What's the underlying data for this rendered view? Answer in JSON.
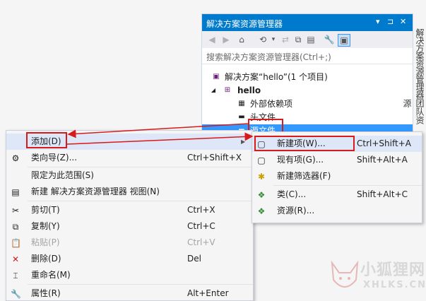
{
  "solution_explorer": {
    "title": "解决方案资源管理器",
    "pin": "▾ ⊐ ✕",
    "search_placeholder": "搜索解决方案资源管理器(Ctrl+;)",
    "tree": [
      {
        "label": "解决方案“hello”(1 个项目)"
      },
      {
        "label": "hello"
      },
      {
        "label": "外部依赖项"
      },
      {
        "label": "头文件"
      },
      {
        "label": "源文件"
      }
    ]
  },
  "side_tabs": {
    "solution": "解决方案资源管理器",
    "team": "团队资源"
  },
  "context_menu": {
    "items": [
      {
        "label": "添加(D)",
        "shortcut": ""
      },
      {
        "label": "类向导(Z)...",
        "shortcut": "Ctrl+Shift+X"
      },
      {
        "label": "限定为此范围(S)",
        "shortcut": ""
      },
      {
        "label": "新建 解决方案资源管理器 视图(N)",
        "shortcut": ""
      },
      {
        "label": "剪切(T)",
        "shortcut": "Ctrl+X"
      },
      {
        "label": "复制(Y)",
        "shortcut": "Ctrl+C"
      },
      {
        "label": "粘贴(P)",
        "shortcut": "Ctrl+V"
      },
      {
        "label": "删除(D)",
        "shortcut": "Del"
      },
      {
        "label": "重命名(M)",
        "shortcut": ""
      },
      {
        "label": "属性(R)",
        "shortcut": "Alt+Enter"
      }
    ]
  },
  "add_submenu": {
    "items": [
      {
        "label": "新建项(W)...",
        "shortcut": "Ctrl+Shift+A"
      },
      {
        "label": "现有项(G)...",
        "shortcut": "Shift+Alt+A"
      },
      {
        "label": "新建筛选器(F)",
        "shortcut": ""
      },
      {
        "label": "类(C)...",
        "shortcut": "Shift+Alt+C"
      },
      {
        "label": "资源(R)...",
        "shortcut": ""
      }
    ]
  },
  "watermark": {
    "cn": "小狐狸网",
    "en": "XHLKS.CN"
  },
  "colors": {
    "accent": "#007acc",
    "selection": "#3399ff",
    "annotation": "#d71a1a"
  }
}
